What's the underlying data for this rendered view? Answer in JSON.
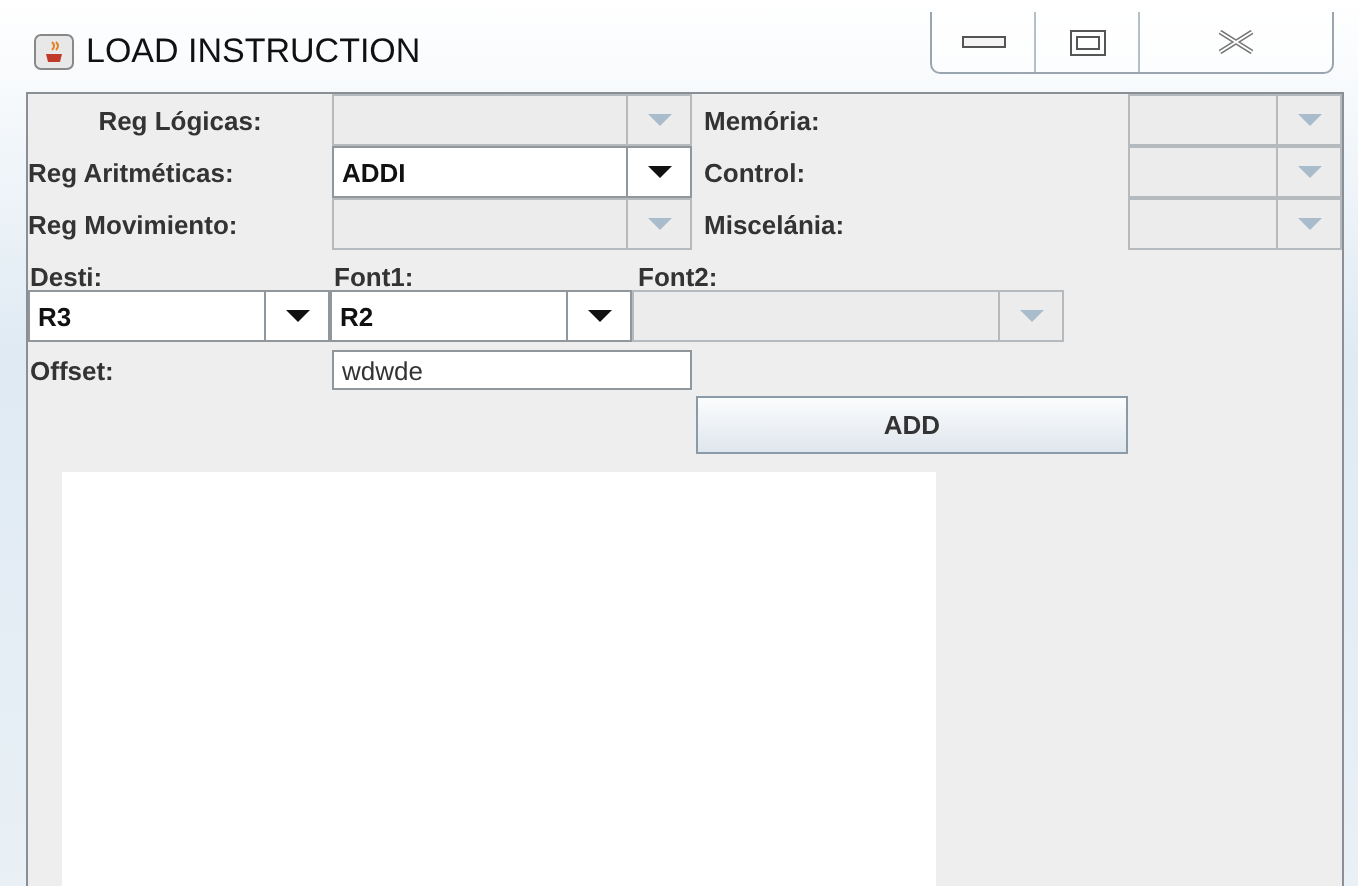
{
  "window": {
    "title": "LOAD INSTRUCTION"
  },
  "category_rows": [
    {
      "left": {
        "label": "Reg Lógicas:",
        "disabled": true
      },
      "right": {
        "label": "Memória:",
        "disabled": true
      }
    },
    {
      "left": {
        "label": "Reg Aritméticas:",
        "value": "ADDI",
        "disabled": false
      },
      "right": {
        "label": "Control:",
        "disabled": true
      }
    },
    {
      "left": {
        "label": "Reg Movimiento:",
        "disabled": true
      },
      "right": {
        "label": "Miscelánia:",
        "disabled": true
      }
    }
  ],
  "operands": [
    {
      "label": "Desti:",
      "value": "R3",
      "disabled": false
    },
    {
      "label": "Font1:",
      "value": "R2",
      "disabled": false
    },
    {
      "label": "Font2:",
      "disabled": true
    }
  ],
  "offset": {
    "label": "Offset:",
    "value": "wdwde"
  },
  "buttons": [
    "ADD"
  ]
}
